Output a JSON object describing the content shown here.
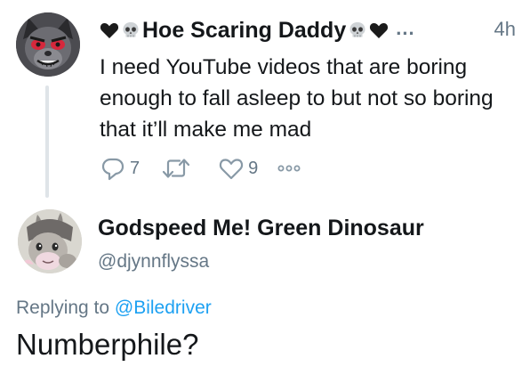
{
  "parent_tweet": {
    "display_name": "Hoe Scaring Daddy",
    "name_emojis_before": [
      "black-heart-icon",
      "skull-icon"
    ],
    "name_emojis_after": [
      "skull-icon",
      "black-heart-icon"
    ],
    "more_indicator": "...",
    "time": "4h",
    "text": "I need YouTube videos that are boring enough to fall asleep to but not so boring that it’ll make me mad",
    "actions": {
      "reply_count": "7",
      "retweet_count": "",
      "like_count": "9"
    }
  },
  "reply": {
    "display_name": "Godspeed Me! Green Dinosaur",
    "handle": "@djynnflyssa",
    "replying_prefix": "Replying to",
    "replying_to": "@Biledriver",
    "text": "Numberphile?"
  },
  "colors": {
    "text_primary": "#14171a",
    "text_secondary": "#657786",
    "link": "#1da1f2",
    "thread_line": "#dfe4e8"
  }
}
